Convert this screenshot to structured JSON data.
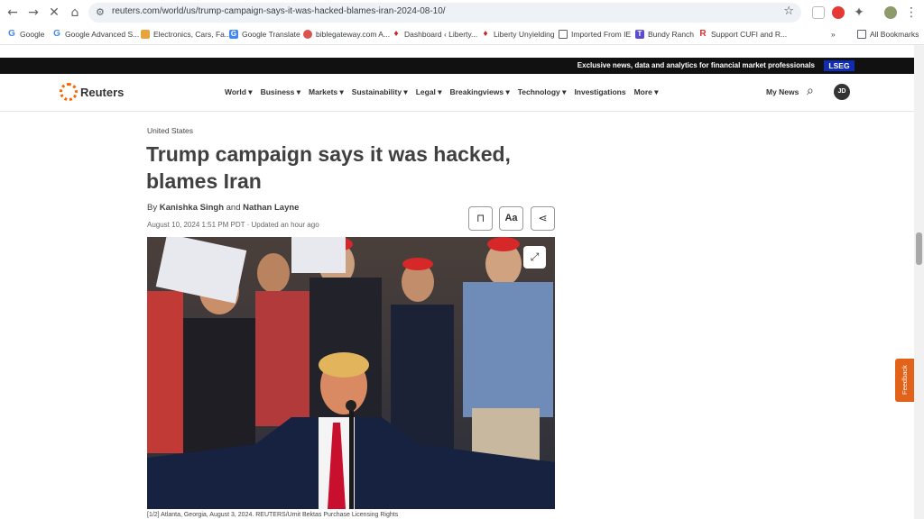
{
  "browser": {
    "url": "reuters.com/world/us/trump-campaign-says-it-was-hacked-blames-iran-2024-08-10/",
    "bookmarks": [
      "Google",
      "Google Advanced S...",
      "Electronics, Cars, Fa...",
      "Google Translate",
      "biblegateway.com A...",
      "Dashboard ‹ Liberty...",
      "Liberty Unyielding",
      "Imported From IE",
      "Bundy Ranch",
      "Support CUFI and R..."
    ],
    "all_bookmarks": "All Bookmarks",
    "more_bookmarks": "»"
  },
  "promo": {
    "text": "Exclusive news, data and analytics for financial market professionals",
    "brand": "LSEG"
  },
  "header": {
    "logo": "Reuters",
    "nav": [
      "World",
      "Business",
      "Markets",
      "Sustainability",
      "Legal",
      "Breakingviews",
      "Technology",
      "Investigations",
      "More"
    ],
    "my_news": "My News",
    "avatar_initials": "JD"
  },
  "article": {
    "kicker": "United States",
    "headline": "Trump campaign says it was hacked, blames Iran",
    "by": "By",
    "author1": "Kanishka Singh",
    "and": "and",
    "author2": "Nathan Layne",
    "date": "August 10, 2024 1:51 PM PDT · Updated an hour ago",
    "text_size_label": "Aa",
    "caption": "[1/2] Atlanta, Georgia, August 3, 2024. REUTERS/Umit Bektas Purchase Licensing Rights"
  },
  "feedback": "Feedback",
  "colors": {
    "accent": "#fa6400",
    "promo_bg": "#111111",
    "lseg": "#0f2db3",
    "feedback": "#e2621a"
  }
}
